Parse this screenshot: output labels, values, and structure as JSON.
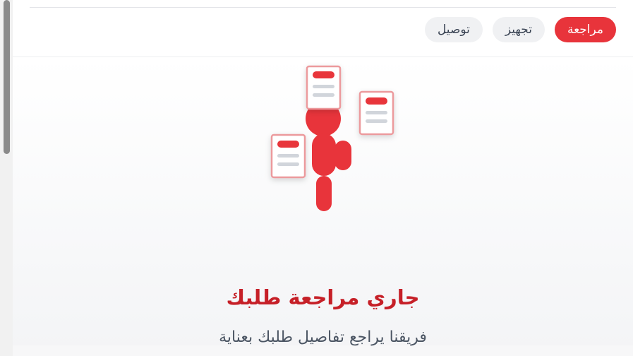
{
  "tabs": [
    {
      "label": "مراجعة",
      "active": true
    },
    {
      "label": "تجهيز",
      "active": false
    },
    {
      "label": "توصيل",
      "active": false
    }
  ],
  "status": {
    "title": "جاري مراجعة طلبك",
    "subtitle": "فريقنا يراجع تفاصيل طلبك بعناية"
  },
  "illustration": {
    "icon": "reviewer-with-documents-icon",
    "accent": "#e8343b",
    "doc_line": "#d1d5db"
  },
  "colors": {
    "accent": "#e8343b",
    "title": "#c62028",
    "tab_bg": "#f0f1f3"
  }
}
